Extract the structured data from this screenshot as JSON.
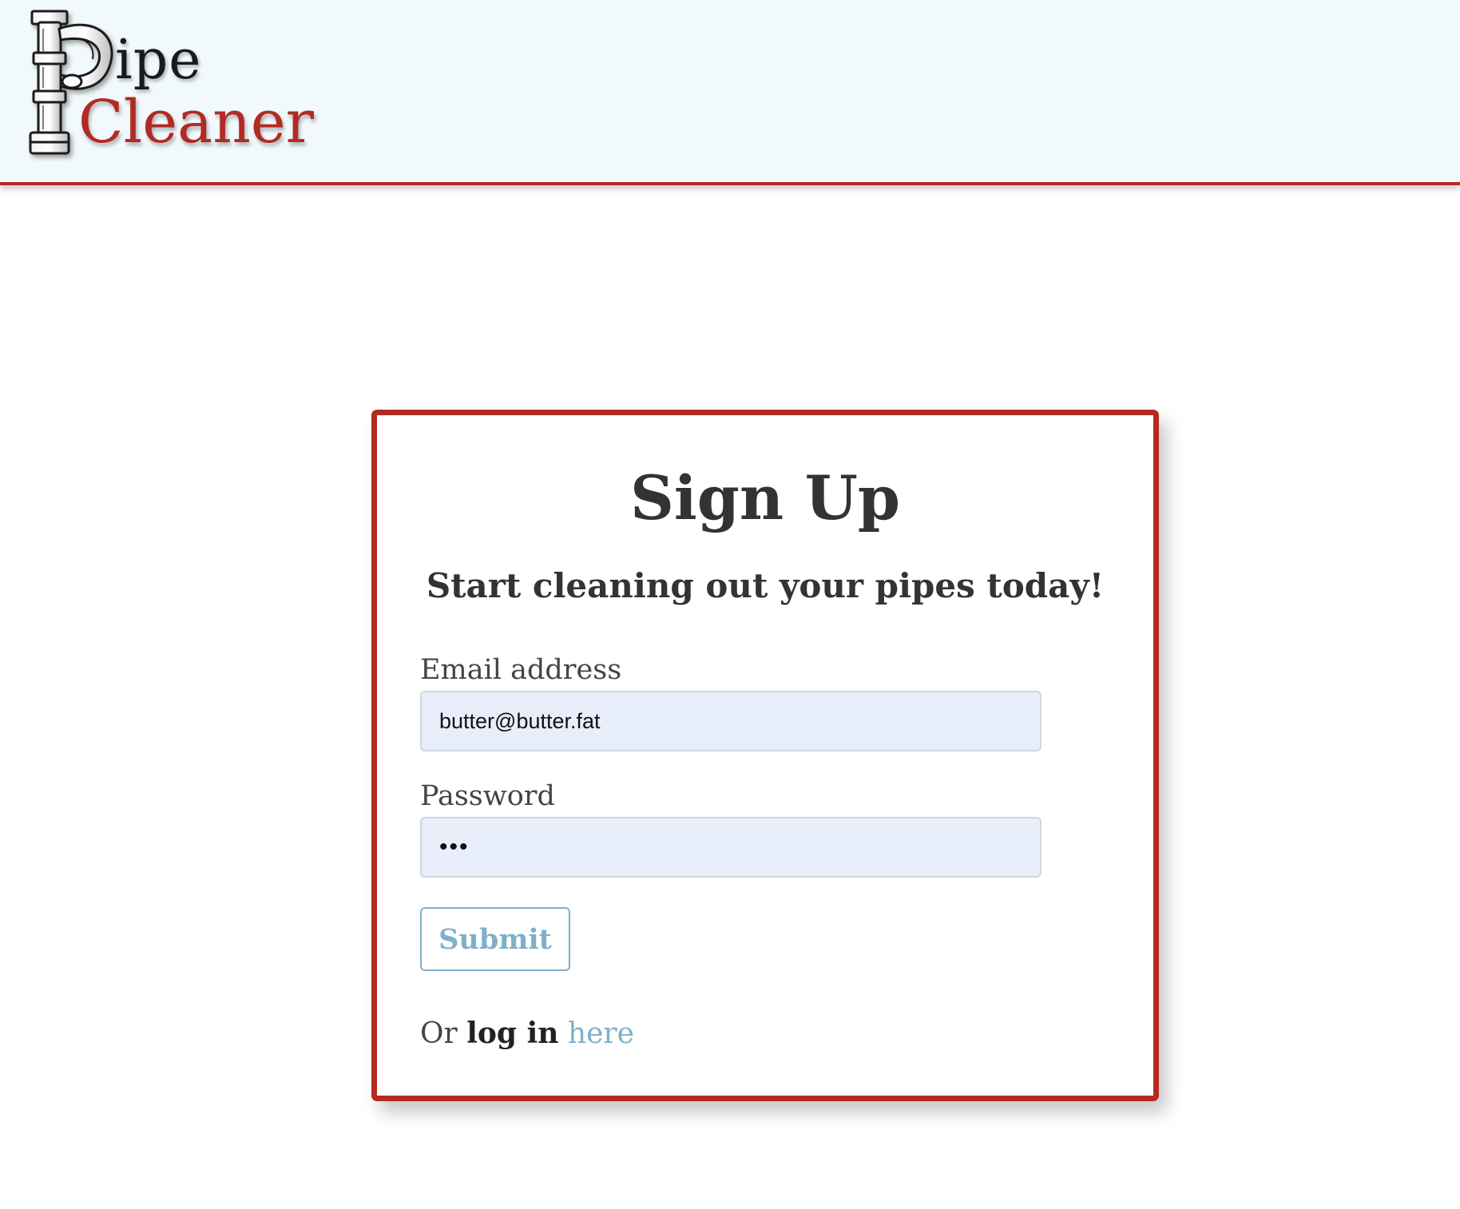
{
  "header": {
    "logo": {
      "icon": "pipe-letter-p-icon",
      "line1": "ipe",
      "line2": "Cleaner"
    }
  },
  "signup": {
    "title": "Sign Up",
    "subtitle": "Start cleaning out your pipes today!",
    "email": {
      "label": "Email address",
      "value": "butter@butter.fat"
    },
    "password": {
      "label": "Password",
      "value": "•••"
    },
    "submit_label": "Submit",
    "login_prompt": {
      "prefix": "Or",
      "bold": "log in",
      "link": "here"
    }
  },
  "colors": {
    "brand_red": "#b22a22",
    "header_bg": "#f1f9fc",
    "link_blue": "#7fb0c9",
    "input_bg": "#e8effb"
  }
}
